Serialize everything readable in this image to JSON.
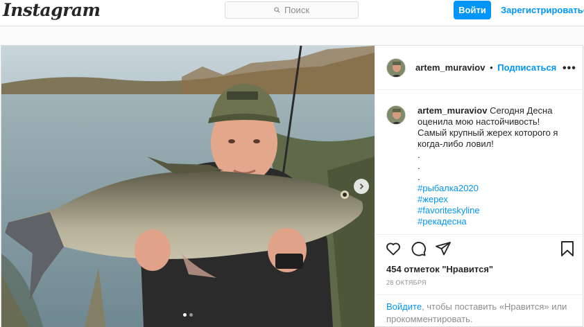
{
  "header": {
    "logo": "Instagram",
    "search_placeholder": "Поиск",
    "login_button": "Войти",
    "signup_link": "Зарегистрироваться"
  },
  "post": {
    "author": "artem_muraviov",
    "separator": "•",
    "follow_label": "Подписаться",
    "more_label": "•••",
    "carousel": {
      "slide_count": 2,
      "active_index": 0
    },
    "caption": {
      "author": "artem_muraviov",
      "text_lines": [
        "Сегодня Десна",
        "оценила мою настойчивость!",
        "Самый крупный жерех которого я",
        "когда-либо ловил!"
      ],
      "dots": [
        ".",
        ".",
        "."
      ],
      "hashtags": [
        "#рыбалка2020",
        "#жерех",
        "#favoriteskyline",
        "#рекадесна"
      ]
    },
    "likes_text": "454 отметок \"Нравится\"",
    "date_text": "28 ОКТЯБРЯ",
    "login_prompt": {
      "login_word": "Войдите",
      "rest": ", чтобы поставить «Нравится» или прокомментировать."
    }
  },
  "icons": [
    "search-icon",
    "heart-icon",
    "comment-icon",
    "share-icon",
    "bookmark-icon",
    "chevron-right-icon",
    "more-icon"
  ],
  "colors": {
    "accent": "#0095f6",
    "border": "#dbdbdb",
    "text": "#262626",
    "muted": "#8e8e8e"
  }
}
